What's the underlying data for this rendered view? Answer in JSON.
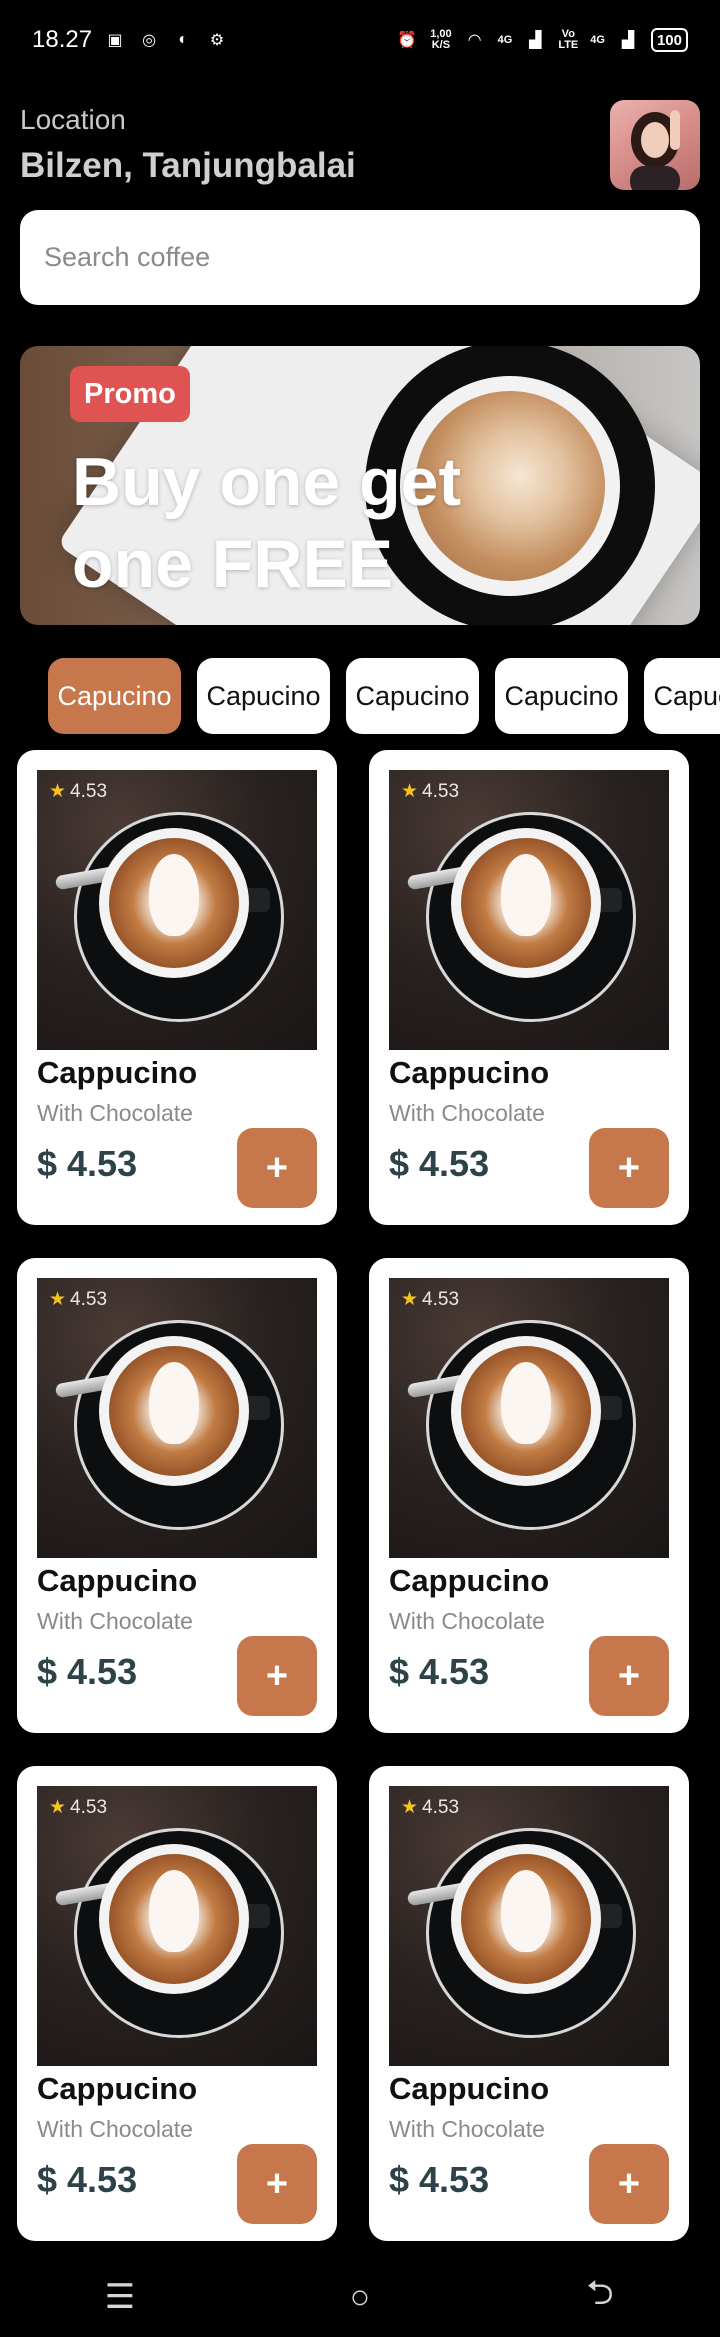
{
  "status_bar": {
    "time": "18.27",
    "left_icons": [
      "notification-icon",
      "instagram-icon",
      "chat-icon",
      "settings-icon"
    ],
    "net_speed_top": "1,00",
    "net_speed_bottom": "K/S",
    "signal_1": "4G",
    "signal_2_top": "Vo",
    "signal_2_bottom": "LTE",
    "signal_3": "4G",
    "battery": "100"
  },
  "header": {
    "location_label": "Location",
    "location_value": "Bilzen, Tanjungbalai"
  },
  "search": {
    "placeholder": "Search coffee"
  },
  "promo": {
    "badge": "Promo",
    "title": "Buy one get one FREE"
  },
  "categories": [
    "Capucino",
    "Capucino",
    "Capucino",
    "Capucino",
    "Capucino"
  ],
  "products": [
    {
      "rating": "4.53",
      "name": "Cappucino",
      "subtitle": "With Chocolate",
      "price": "$ 4.53",
      "add_label": "+"
    },
    {
      "rating": "4.53",
      "name": "Cappucino",
      "subtitle": "With Chocolate",
      "price": "$ 4.53",
      "add_label": "+"
    },
    {
      "rating": "4.53",
      "name": "Cappucino",
      "subtitle": "With Chocolate",
      "price": "$ 4.53",
      "add_label": "+"
    },
    {
      "rating": "4.53",
      "name": "Cappucino",
      "subtitle": "With Chocolate",
      "price": "$ 4.53",
      "add_label": "+"
    },
    {
      "rating": "4.53",
      "name": "Cappucino",
      "subtitle": "With Chocolate",
      "price": "$ 4.53",
      "add_label": "+"
    },
    {
      "rating": "4.53",
      "name": "Cappucino",
      "subtitle": "With Chocolate",
      "price": "$ 4.53",
      "add_label": "+"
    }
  ],
  "colors": {
    "accent": "#c6774b",
    "promo_badge": "#e05353",
    "price_text": "#2e4249",
    "star": "#f4c21c"
  },
  "nav": {
    "menu_icon": "☰",
    "home_icon": "○",
    "back_icon": "⮌"
  }
}
